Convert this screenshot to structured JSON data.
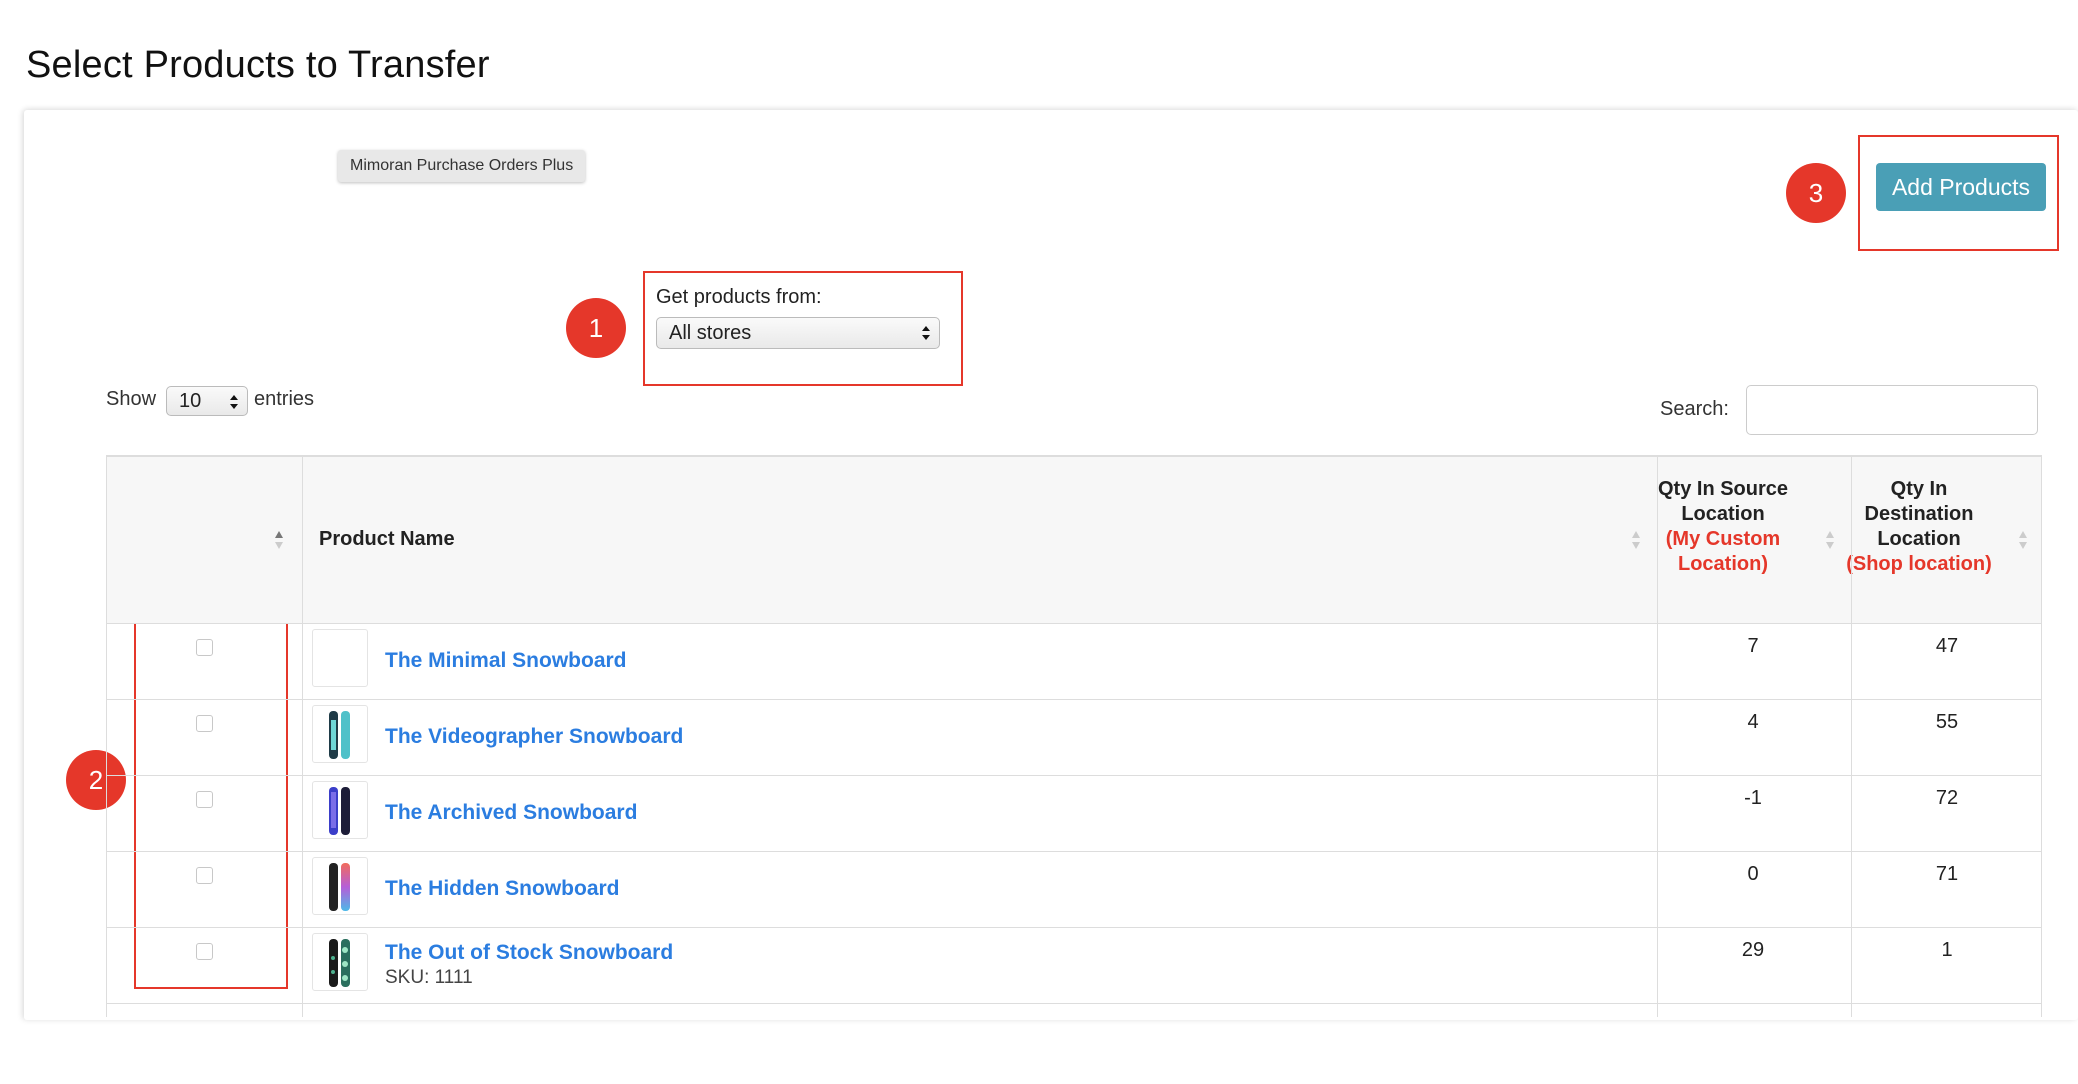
{
  "page": {
    "title": "Select Products to Transfer"
  },
  "tooltip": {
    "text": "Mimoran Purchase Orders Plus"
  },
  "annotations": {
    "one": "1",
    "two": "2",
    "three": "3"
  },
  "actions": {
    "add_products_label": "Add Products"
  },
  "filter": {
    "label": "Get products from:",
    "selected": "All stores"
  },
  "length": {
    "show_label": "Show",
    "value": "10",
    "entries_label": "entries"
  },
  "search": {
    "label": "Search:",
    "value": "",
    "placeholder": ""
  },
  "table": {
    "headers": {
      "product_name": "Product Name",
      "qty_source": "Qty In Source Location",
      "qty_source_location": "(My Custom Location)",
      "qty_dest": "Qty In Destination Location",
      "qty_dest_location": "(Shop location)"
    },
    "rows": [
      {
        "name": "The Minimal Snowboard",
        "sku": "",
        "qty_source": "7",
        "qty_dest": "47",
        "thumb": "none"
      },
      {
        "name": "The Videographer Snowboard",
        "sku": "",
        "qty_source": "4",
        "qty_dest": "55",
        "thumb": "teal-board-icon"
      },
      {
        "name": "The Archived Snowboard",
        "sku": "",
        "qty_source": "-1",
        "qty_dest": "72",
        "thumb": "purple-board-icon"
      },
      {
        "name": "The Hidden Snowboard",
        "sku": "",
        "qty_source": "0",
        "qty_dest": "71",
        "thumb": "gradient-board-icon"
      },
      {
        "name": "The Out of Stock Snowboard",
        "sku": "SKU: 1111",
        "qty_source": "29",
        "qty_dest": "1",
        "thumb": "pattern-board-icon"
      }
    ]
  },
  "colors": {
    "accent": "#4a9fb6",
    "link": "#2b7de0",
    "annotation": "#e5372a"
  }
}
